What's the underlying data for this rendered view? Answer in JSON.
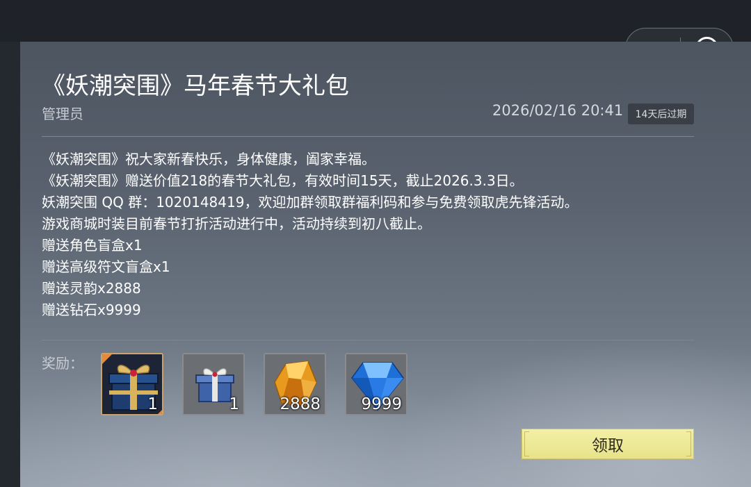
{
  "post": {
    "title": "《妖潮突围》马年春节大礼包",
    "author": "管理员",
    "date": "2026/02/16 20:41",
    "expire_badge": "14天后过期",
    "body_lines": [
      "《妖潮突围》祝大家新春快乐，身体健康，阖家幸福。",
      "《妖潮突围》赠送价值218的春节大礼包，有效时间15天，截止2026.3.3日。",
      "妖潮突围 QQ 群：1020148419，欢迎加群领取群福利码和参与免费领取虎先锋活动。",
      "游戏商城时装目前春节打折活动进行中，活动持续到初八截止。",
      "赠送角色盲盒x1",
      "赠送高级符文盲盒x1",
      "赠送灵韵x2888",
      "赠送钻石x9999"
    ]
  },
  "rewards": {
    "label": "奖励：",
    "items": [
      {
        "icon": "character-blind-box-icon",
        "count": "1"
      },
      {
        "icon": "rune-blind-box-icon",
        "count": "1"
      },
      {
        "icon": "spirit-crystal-icon",
        "count": "2888"
      },
      {
        "icon": "diamond-icon",
        "count": "9999"
      }
    ]
  },
  "actions": {
    "claim_label": "领取"
  },
  "capsule": {
    "more_icon": "more-dots-icon",
    "close_icon": "close-target-icon"
  },
  "colors": {
    "claim_button": "#f0ec9c",
    "panel": "#59626e",
    "accent_text": "#ffffff"
  }
}
